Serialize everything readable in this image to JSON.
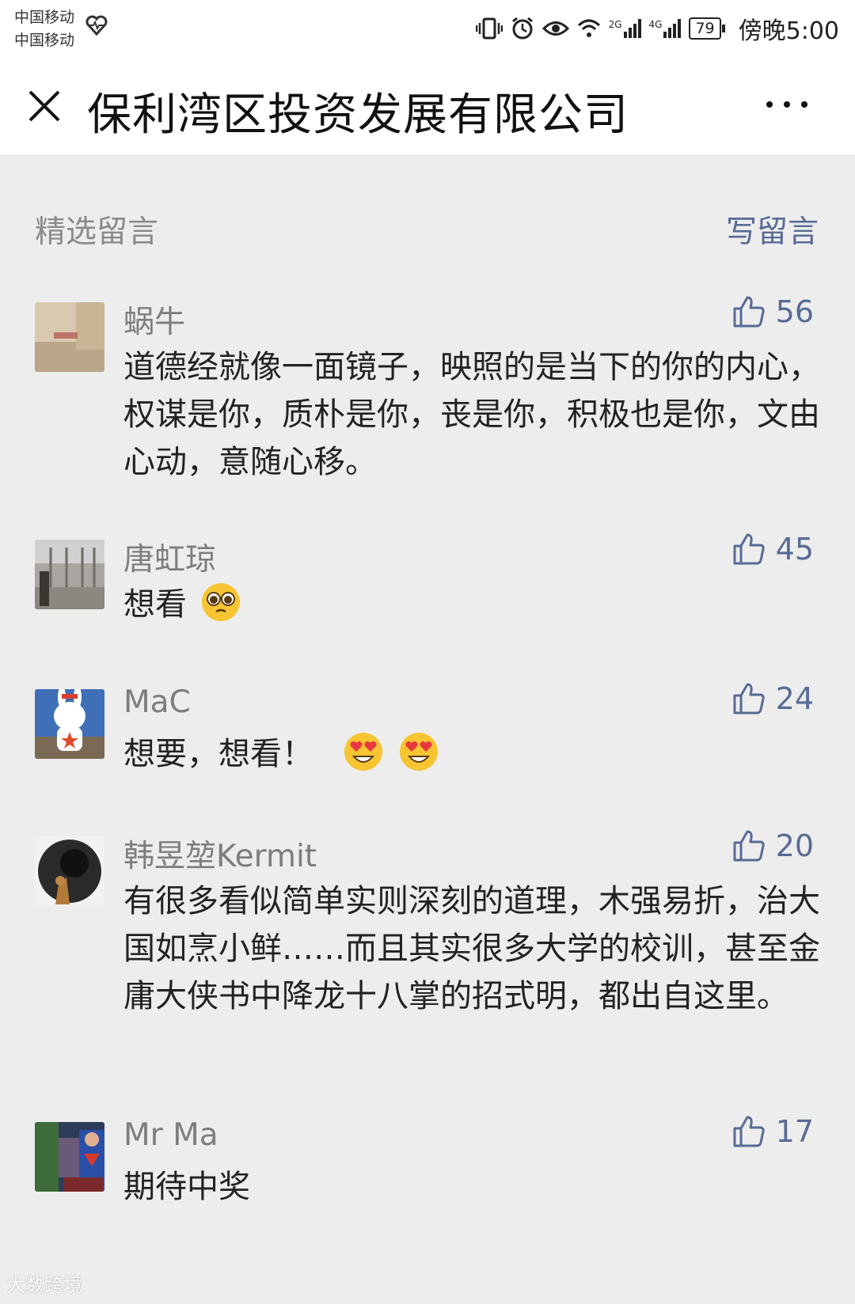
{
  "status_bar": {
    "carrier_1": "中国移动",
    "carrier_2": "中国移动",
    "net_1": "2G",
    "net_2": "4G",
    "battery": "79",
    "time": "傍晚5:00"
  },
  "header": {
    "title": "保利湾区投资发展有限公司"
  },
  "section": {
    "label": "精选留言",
    "write_label": "写留言"
  },
  "comments": [
    {
      "name": "蜗牛",
      "likes": "56",
      "text": "道德经就像一面镜子，映照的是当下的你的内心，权谋是你，质朴是你，丧是你，积极也是你，文由心动，意随心移。"
    },
    {
      "name": "唐虹琼",
      "likes": "45",
      "text": "想看"
    },
    {
      "name": "MaC",
      "likes": "24",
      "text": "想要，想看！"
    },
    {
      "name": "韩昱堃Kermit",
      "likes": "20",
      "text": "有很多看似简单实则深刻的道理，木强易折，治大国如烹小鲜……而且其实很多大学的校训，甚至金庸大侠书中降龙十八掌的招式明，都出自这里。"
    },
    {
      "name": "Mr Ma",
      "likes": "17",
      "text": "期待中奖"
    }
  ],
  "watermark": "大数跨境",
  "colors": {
    "link": "#576b95",
    "background": "#ededed",
    "name": "#7d7d7d"
  }
}
